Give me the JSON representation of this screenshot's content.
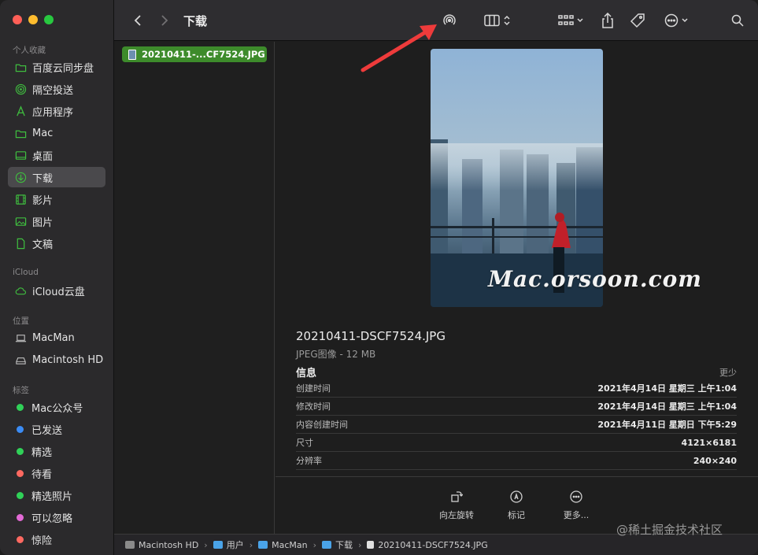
{
  "window": {
    "title": "下载"
  },
  "sidebar": {
    "favorites_label": "个人收藏",
    "favorites": [
      {
        "label": "百度云同步盘",
        "icon": "folder-icon"
      },
      {
        "label": "隔空投送",
        "icon": "airdrop-icon"
      },
      {
        "label": "应用程序",
        "icon": "applications-icon"
      },
      {
        "label": "Mac",
        "icon": "folder-icon"
      },
      {
        "label": "桌面",
        "icon": "desktop-icon"
      },
      {
        "label": "下载",
        "icon": "downloads-icon",
        "selected": true
      },
      {
        "label": "影片",
        "icon": "movies-icon"
      },
      {
        "label": "图片",
        "icon": "pictures-icon"
      },
      {
        "label": "文稿",
        "icon": "documents-icon"
      }
    ],
    "icloud_label": "iCloud",
    "icloud": [
      {
        "label": "iCloud云盘",
        "icon": "cloud-icon"
      }
    ],
    "locations_label": "位置",
    "locations": [
      {
        "label": "MacMan",
        "icon": "laptop-icon"
      },
      {
        "label": "Macintosh HD",
        "icon": "disk-icon"
      }
    ],
    "tags_label": "标签",
    "tags": [
      {
        "label": "Mac公众号",
        "color": "#30d158"
      },
      {
        "label": "已发送",
        "color": "#3b8cf5"
      },
      {
        "label": "精选",
        "color": "#30d158"
      },
      {
        "label": "待看",
        "color": "#ff6961"
      },
      {
        "label": "精选照片",
        "color": "#30d158"
      },
      {
        "label": "可以忽略",
        "color": "#e36ad6"
      },
      {
        "label": "惊险",
        "color": "#ff6961"
      }
    ]
  },
  "toolbar": {
    "back": "chevron-left-icon",
    "forward": "chevron-right-icon",
    "airdrop": "airdrop-icon",
    "view": "columns-view-icon",
    "group": "grid-group-icon",
    "share": "share-icon",
    "tags": "tag-icon",
    "more": "ellipsis-circle-icon",
    "search": "search-icon"
  },
  "column": {
    "selected_file": "20210411-...CF7524.JPG"
  },
  "preview": {
    "file_name": "20210411-DSCF7524.JPG",
    "file_type": "JPEG图像 - 12 MB",
    "info_title": "信息",
    "more_label": "更少",
    "info": [
      {
        "key": "创建时间",
        "value": "2021年4月14日 星期三 上午1:04"
      },
      {
        "key": "修改时间",
        "value": "2021年4月14日 星期三 上午1:04"
      },
      {
        "key": "内容创建时间",
        "value": "2021年4月11日 星期日 下午5:29"
      },
      {
        "key": "尺寸",
        "value": "4121×6181"
      },
      {
        "key": "分辨率",
        "value": "240×240"
      }
    ],
    "actions": [
      {
        "label": "向左旋转",
        "icon": "rotate-left-icon"
      },
      {
        "label": "标记",
        "icon": "markup-icon"
      },
      {
        "label": "更多...",
        "icon": "more-icon"
      }
    ]
  },
  "pathbar": [
    "Macintosh HD",
    "用户",
    "MacMan",
    "下载",
    "20210411-DSCF7524.JPG"
  ],
  "watermarks": {
    "brand": "Mac.orsoon.com",
    "site": "@稀土掘金技术社区"
  },
  "colors": {
    "selection_green": "#3d8b2b",
    "annotation_arrow": "#ee3b3b"
  }
}
